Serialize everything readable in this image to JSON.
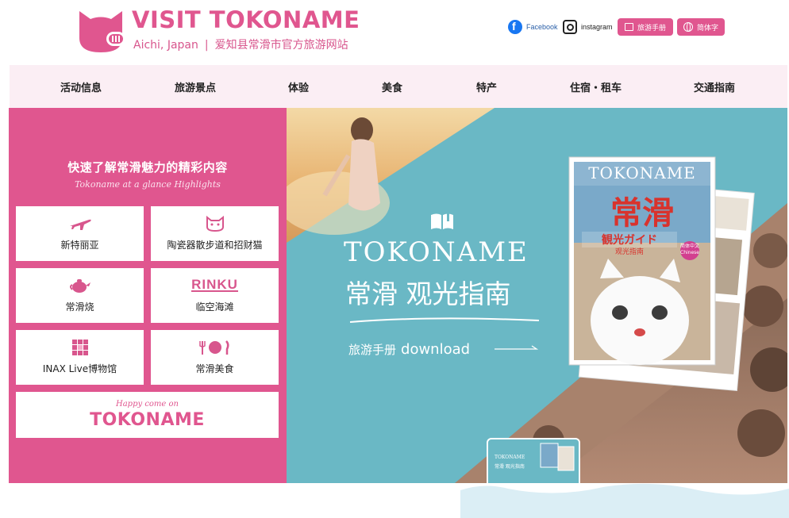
{
  "header": {
    "brand_title": "VISIT TOKONAME",
    "brand_location": "Aichi, Japan",
    "brand_divider": "|",
    "brand_desc": "爱知县常滑市官方旅游网站",
    "social": [
      {
        "label": "Facebook",
        "icon": "facebook-icon"
      },
      {
        "label": "instagram",
        "icon": "instagram-icon"
      }
    ],
    "guide_button": "旅游手册",
    "lang_button": "简体字",
    "colors": {
      "brand_pink": "#e0568f",
      "nav_bg": "#fbeef4",
      "hero_teal": "#6ab8c5"
    }
  },
  "nav": {
    "items": [
      "活动信息",
      "旅游景点",
      "体验",
      "美食",
      "特产",
      "住宿・租车",
      "交通指南"
    ]
  },
  "panel": {
    "title": "快速了解常滑魅力的精彩内容",
    "subtitle": "Tokoname at a glance Highlights",
    "tiles": [
      {
        "label": "新特丽亚",
        "icon": "airplane-icon"
      },
      {
        "label": "陶瓷器散步道和招财猫",
        "icon": "lucky-cat-icon"
      },
      {
        "label": "常滑烧",
        "icon": "teapot-icon"
      },
      {
        "label": "临空海滩",
        "icon": "rinku-logo",
        "logo_text": "RINKU"
      },
      {
        "label": "INAX Live博物馆",
        "icon": "tile-grid-icon"
      },
      {
        "label": "常滑美食",
        "icon": "cutlery-icon"
      }
    ],
    "banner": {
      "small": "Happy come on",
      "title": "TOKONAME"
    }
  },
  "hero": {
    "title": "TOKONAME",
    "subtitle": "常滑 观光指南",
    "download_cn": "旅游手册",
    "download_en": "download",
    "brochure": {
      "cover_title": "TOKONAME",
      "cover_kanji": "常滑",
      "cover_sub": "観光ガイド",
      "cover_sub2": "观光指南",
      "badge": "简体中文",
      "badge_en": "Chinese"
    },
    "thumb": {
      "title": "TOKONAME",
      "sub": "常滑 观光指南"
    }
  }
}
